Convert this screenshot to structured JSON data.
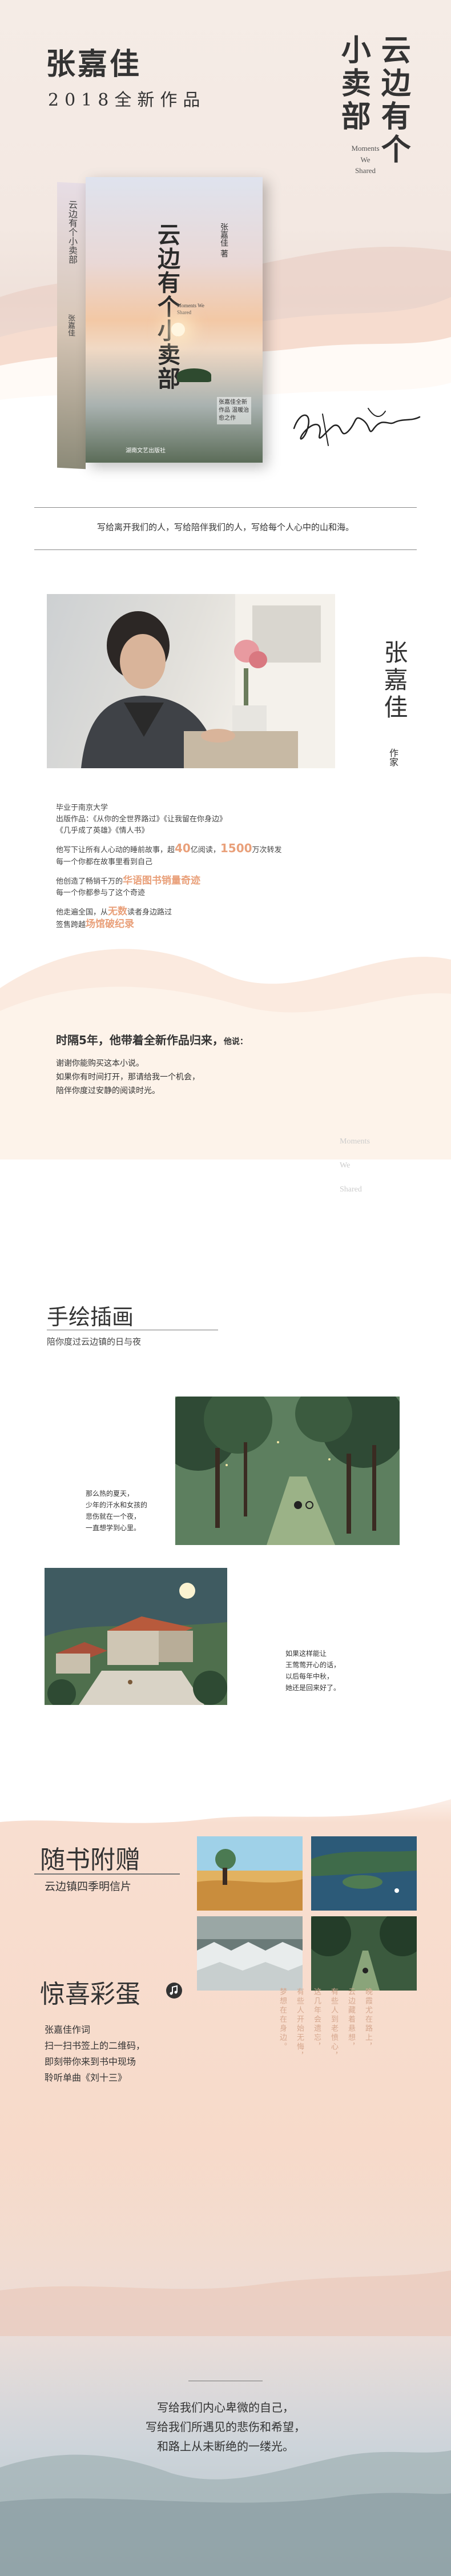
{
  "cover": {
    "author": "张嘉佳",
    "subtitle": "2018全新作品",
    "title_col1": "云边有个",
    "title_col2": "小卖部",
    "en_title": [
      "Moments",
      "We",
      "Shared"
    ],
    "book": {
      "spine_text": "云边有个小卖部",
      "spine_author": "张嘉佳",
      "front_title": "云边有个小卖部",
      "front_author": "张嘉佳 著",
      "front_en": "Moments We Shared",
      "tag": "张嘉佳全新作品 温暖治愈之作",
      "publisher": "湖南文艺出版社"
    },
    "signature": "张嘉佳",
    "colors": {
      "ink": "#333333",
      "accent": "#e9a07a",
      "peach": "#f6d8c6"
    }
  },
  "quote1": "写给离开我们的人，写给陪伴我们的人，写给每个人心中的山和海。",
  "author": {
    "name": "张嘉佳",
    "role": "作家",
    "bio": {
      "school": "毕业于南京大学",
      "works": "出版作品：《从你的全世界路过》《让我留在你身边》",
      "works2": "《几乎成了英雄》《情人书》",
      "line1a": "他写下让所有人心动的睡前故事，超",
      "num1": "40",
      "line1b": "亿阅读，",
      "num2": "1500",
      "line1c": "万次转发",
      "line2": "每一个你都在故事里看到自己",
      "line3a": "他创造了畅销千万的",
      "line3hl": "华语图书销量奇迹",
      "line4": "每一个你都参与了这个奇迹",
      "line5a": "他走遍全国，从",
      "line5hl": "无数",
      "line5b": "读者身边路过",
      "line6a": "签售跨越",
      "line6hl": "场馆破纪录"
    },
    "back": {
      "title_a": "时隔5年，他带着全新作品归来，",
      "title_b": "他说：",
      "lines": [
        "谢谢你能购买这本小说。",
        "如果你有时间打开，那请给我一个机会，",
        "陪伴你度过安静的阅读时光。"
      ]
    },
    "faint_en": [
      "Moments",
      "We",
      "Shared"
    ]
  },
  "illus": {
    "title": "手绘插画",
    "sub": "陪你度过云边镇的日与夜",
    "cap1": [
      "那么热的夏天，",
      "少年的汗水和女孩的",
      "悲伤就在一个夜，",
      "一直想学到心里。"
    ],
    "cap2": [
      "如果这样能让",
      "王莺莺开心的话，",
      "以后每年中秋，",
      "她还是回来好了。"
    ]
  },
  "gifts": {
    "title": "随书附赠",
    "sub": "云边镇四季明信片",
    "egg_title": "惊喜彩蛋",
    "egg_lines": [
      "张嘉佳作词",
      "扫一扫书签上的二维码，",
      "即刻带你来到书中现场",
      "聆听单曲《刘十三》"
    ],
    "poem": [
      "晚霞尤在路上，",
      "云边藏着悬想，",
      "有些人到老愤心，",
      "这几年会遗忘，",
      "有些人开始无悔，",
      "梦想在在身边。"
    ]
  },
  "footer": {
    "lines": [
      "写给我们内心卑微的自己，",
      "写给我们所遇见的悲伤和希望，",
      "和路上从未断绝的一缕光。"
    ]
  }
}
